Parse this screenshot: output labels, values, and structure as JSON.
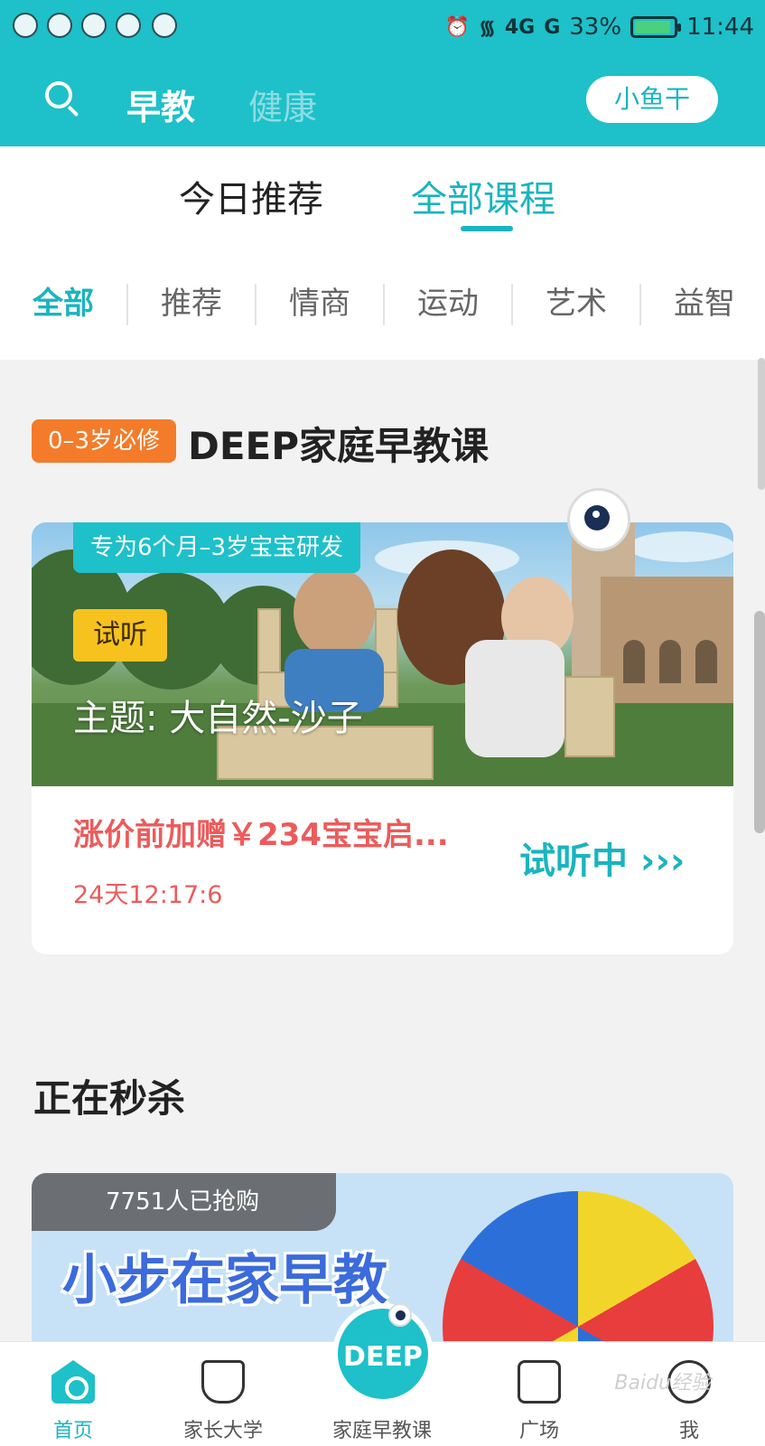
{
  "status_bar": {
    "battery_percent": "33%",
    "time": "11:44",
    "network_1": "4G",
    "network_2": "G",
    "battery_fill_fraction": 0.85
  },
  "header": {
    "tabs": [
      "早教",
      "健康"
    ],
    "active_tab": "早教",
    "right_button": "小鱼干"
  },
  "course_tabs": {
    "items": [
      "今日推荐",
      "全部课程"
    ],
    "active": "全部课程"
  },
  "categories": {
    "items": [
      "全部",
      "推荐",
      "情商",
      "运动",
      "艺术",
      "益智"
    ],
    "active": "全部"
  },
  "section": {
    "age_badge": "0–3岁必修",
    "title": "DEEP家庭早教课"
  },
  "course_card": {
    "image_tag": "专为6个月–3岁宝宝研发",
    "trial_badge": "试听",
    "theme": "主题: 大自然-沙子",
    "promo": "涨价前加赠￥234宝宝启...",
    "countdown": "24天12:17:6",
    "trial_status": "试听中 ›››"
  },
  "flash_sale": {
    "title": "正在秒杀",
    "buyers": "7751人已抢购",
    "headline": "小步在家早教"
  },
  "bottom_nav": {
    "items": [
      "首页",
      "家长大学",
      "家庭早教课",
      "广场",
      "我"
    ],
    "active": "首页",
    "center_badge": "DEEP"
  },
  "watermark": "Baidu经验",
  "colors": {
    "primary": "#1ec0c9",
    "accent_red": "#ec5b5b",
    "badge_orange": "#f47b2a",
    "badge_yellow": "#f7c21d"
  }
}
